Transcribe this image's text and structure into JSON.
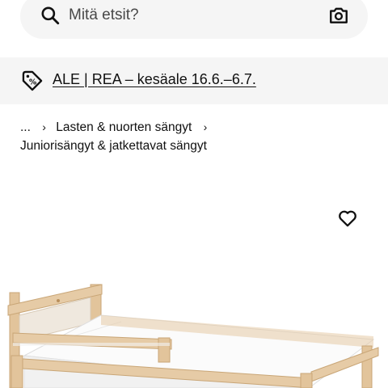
{
  "search": {
    "placeholder": "Mitä etsit?"
  },
  "promo": {
    "text": "ALE | REA – kesäale 16.6.–6.7."
  },
  "breadcrumb": {
    "ellipsis": "...",
    "items": [
      "Lasten & nuorten sängyt",
      "Juniorisängyt & jatkettavat sängyt"
    ]
  },
  "product": {
    "image_name": "junior-bed-with-mattress-image",
    "favourite_icon": "heart-icon"
  },
  "colors": {
    "background": "#ffffff",
    "search_bg": "#f5f5f5",
    "promo_bg": "#f5f5f5",
    "text": "#111111",
    "wood": "#e4c9a3",
    "mattress": "#fafafa"
  }
}
